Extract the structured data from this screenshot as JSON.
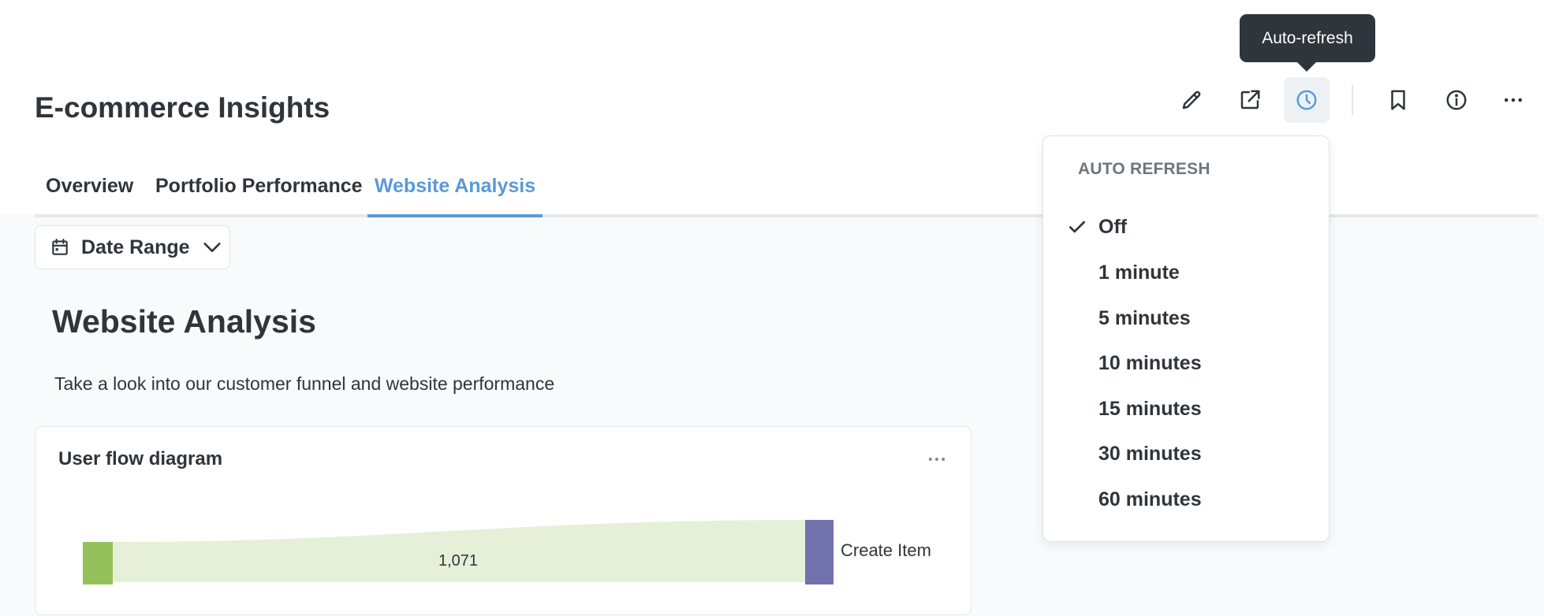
{
  "header": {
    "title": "E-commerce Insights",
    "actions": [
      "pencil-icon",
      "share-icon",
      "clock-icon",
      "bookmark-icon",
      "info-icon",
      "more-icon"
    ],
    "active_action": "auto-refresh",
    "tooltip": "Auto-refresh"
  },
  "tabs": [
    {
      "label": "Overview",
      "active": false
    },
    {
      "label": "Portfolio Performance",
      "active": false
    },
    {
      "label": "Website Analysis",
      "active": true
    }
  ],
  "filter": {
    "label": "Date Range",
    "icon": "calendar-icon"
  },
  "section": {
    "title": "Website Analysis",
    "description": "Take a look into our customer funnel and website performance"
  },
  "card": {
    "title": "User flow diagram",
    "flow_value": "1,071",
    "target_label": "Create Item"
  },
  "auto_refresh_menu": {
    "heading": "AUTO REFRESH",
    "selected": "Off",
    "options": [
      "Off",
      "1 minute",
      "5 minutes",
      "10 minutes",
      "15 minutes",
      "30 minutes",
      "60 minutes"
    ]
  },
  "colors": {
    "accent": "#5a9ad6",
    "text": "#2e353b",
    "source_node": "#95c15a",
    "target_node": "#7172ad",
    "flow": "#e6f0d9"
  }
}
